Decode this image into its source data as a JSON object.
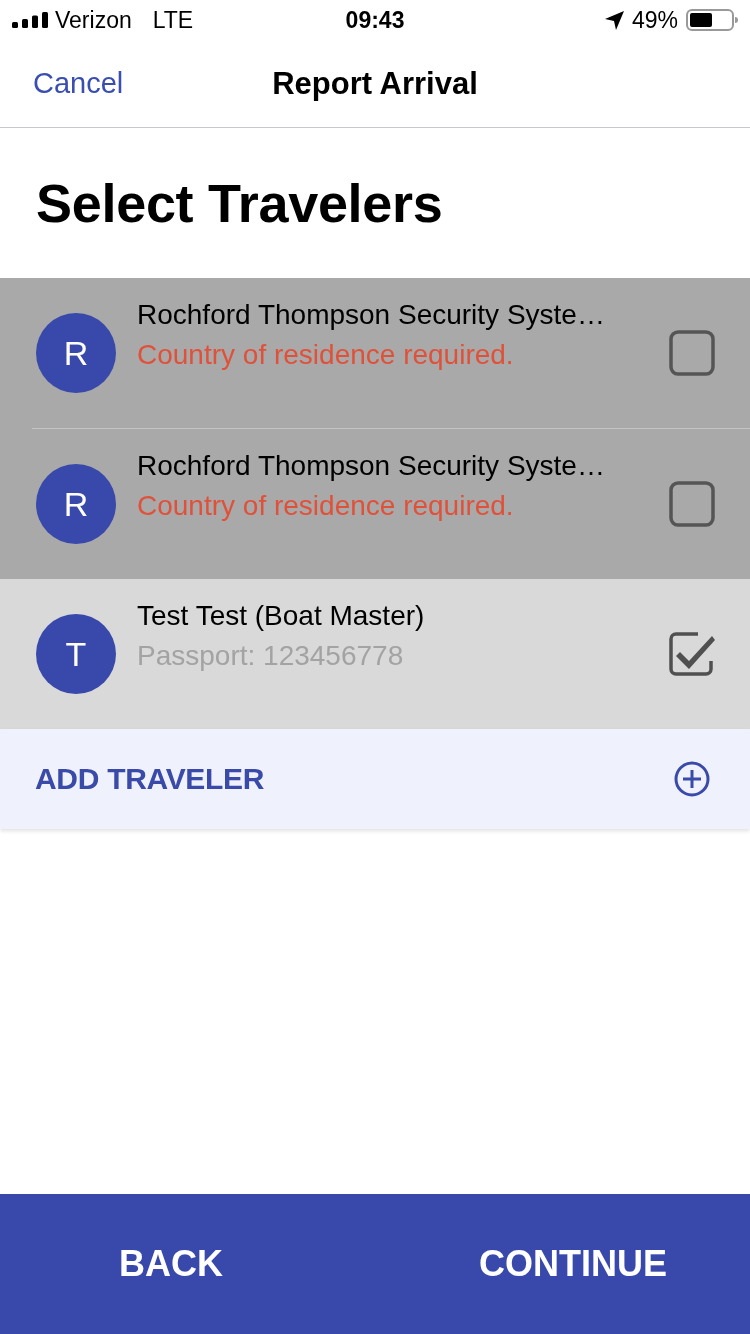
{
  "status_bar": {
    "carrier": "Verizon",
    "network": "LTE",
    "time": "09:43",
    "battery": "49%"
  },
  "nav_bar": {
    "cancel": "Cancel",
    "title": "Report Arrival"
  },
  "heading": "Select Travelers",
  "travelers": [
    {
      "initial": "R",
      "name": "Rochford Thompson Security Syste…",
      "detail": {
        "kind": "error",
        "text": "Country of residence required."
      },
      "disabled": true,
      "checked": false
    },
    {
      "initial": "R",
      "name": "Rochford Thompson Security Syste…",
      "detail": {
        "kind": "error",
        "text": "Country of residence required."
      },
      "disabled": true,
      "checked": false
    },
    {
      "initial": "T",
      "name": "Test Test (Boat Master)",
      "detail": {
        "kind": "info",
        "text": "Passport: 123456778"
      },
      "disabled": false,
      "checked": true
    }
  ],
  "add_traveler": {
    "label": "ADD TRAVELER"
  },
  "footer": {
    "buttons": [
      "BACK",
      "CONTINUE"
    ]
  }
}
